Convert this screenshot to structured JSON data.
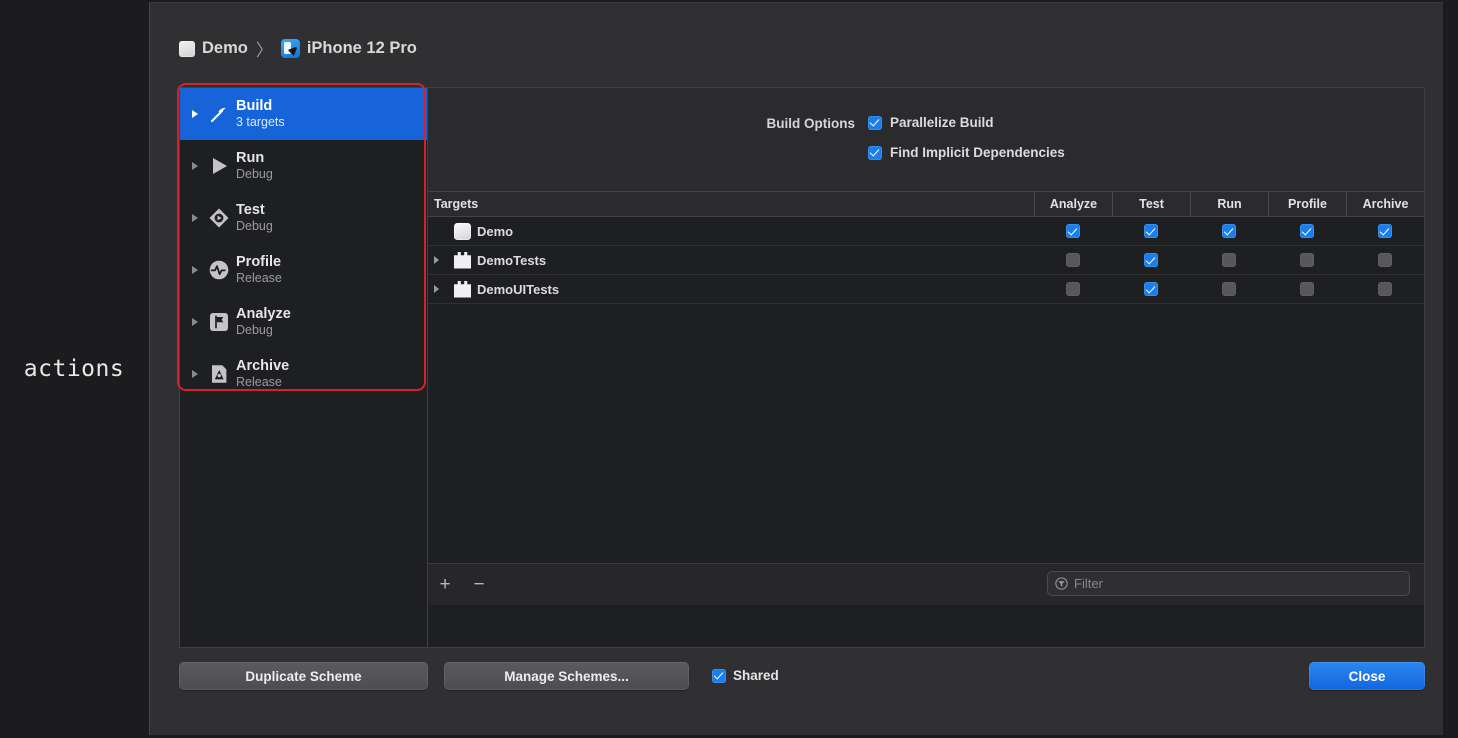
{
  "annotation": {
    "label": "actions"
  },
  "breadcrumb": {
    "project_icon": "app-target-icon",
    "project": "Demo",
    "separator": "〉",
    "device_icon": "ios-simulator-icon",
    "device": "iPhone 12 Pro"
  },
  "sidebar": {
    "items": [
      {
        "icon": "hammer-icon",
        "title": "Build",
        "subtitle": "3 targets",
        "selected": true
      },
      {
        "icon": "play-icon",
        "title": "Run",
        "subtitle": "Debug",
        "selected": false
      },
      {
        "icon": "diamond-play-icon",
        "title": "Test",
        "subtitle": "Debug",
        "selected": false
      },
      {
        "icon": "waveform-icon",
        "title": "Profile",
        "subtitle": "Release",
        "selected": false
      },
      {
        "icon": "flag-square-icon",
        "title": "Analyze",
        "subtitle": "Debug",
        "selected": false
      },
      {
        "icon": "archive-icon",
        "title": "Archive",
        "subtitle": "Release",
        "selected": false
      }
    ],
    "highlight_color": "#d3222f"
  },
  "build_options": {
    "label": "Build Options",
    "checkboxes": [
      {
        "label": "Parallelize Build",
        "checked": true
      },
      {
        "label": "Find Implicit Dependencies",
        "checked": true
      }
    ]
  },
  "targets_table": {
    "columns": [
      "Targets",
      "Analyze",
      "Test",
      "Run",
      "Profile",
      "Archive"
    ],
    "rows": [
      {
        "name": "Demo",
        "icon": "app-target-icon",
        "expandable": false,
        "analyze": true,
        "test": true,
        "run": true,
        "profile": true,
        "archive": true
      },
      {
        "name": "DemoTests",
        "icon": "test-bundle-icon",
        "expandable": true,
        "analyze": false,
        "test": true,
        "run": false,
        "profile": false,
        "archive": false
      },
      {
        "name": "DemoUITests",
        "icon": "test-bundle-icon",
        "expandable": true,
        "analyze": false,
        "test": true,
        "run": false,
        "profile": false,
        "archive": false
      }
    ]
  },
  "table_footer": {
    "add_label": "+",
    "remove_label": "−",
    "filter_icon": "filter-funnel-icon",
    "filter_placeholder": "Filter"
  },
  "footer_bar": {
    "duplicate_scheme": "Duplicate Scheme",
    "manage_schemes": "Manage Schemes...",
    "shared_label": "Shared",
    "shared_checked": true,
    "close": "Close",
    "accent_color": "#1a7fec"
  }
}
